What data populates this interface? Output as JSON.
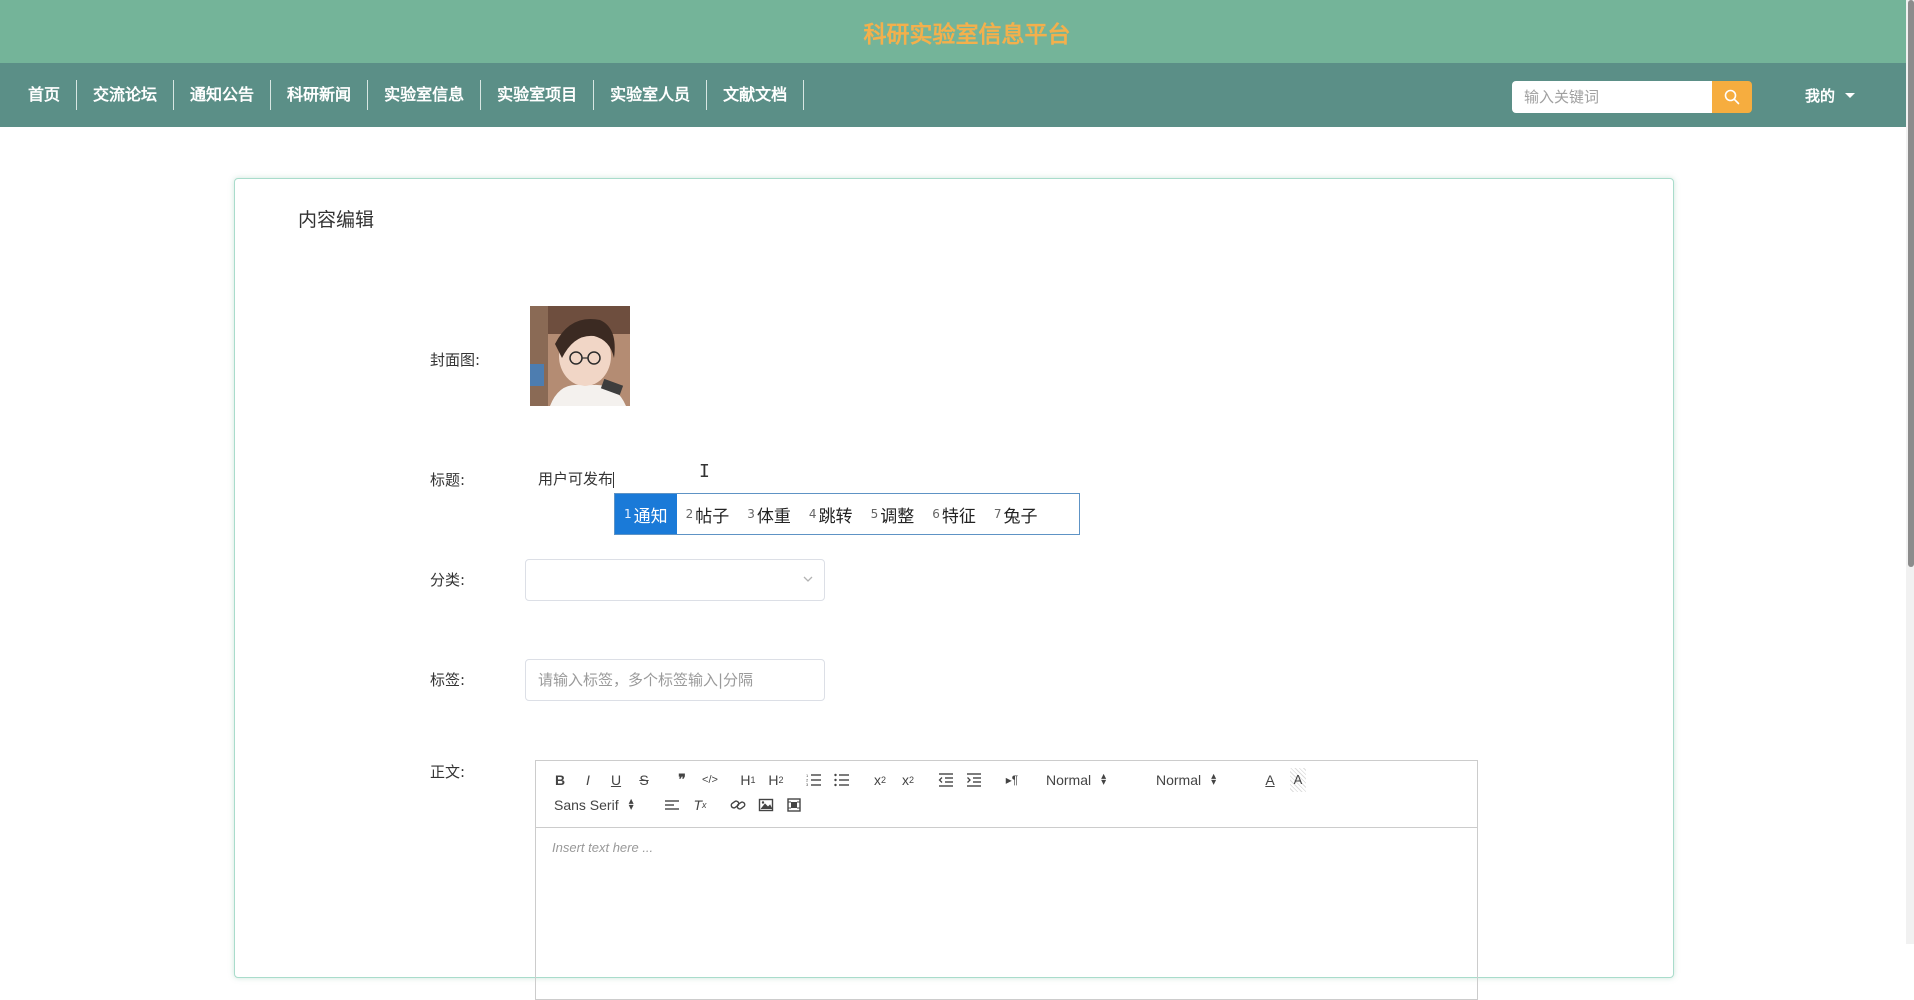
{
  "header": {
    "site_title": "科研实验室信息平台"
  },
  "nav": {
    "items": [
      {
        "label": "首页"
      },
      {
        "label": "交流论坛"
      },
      {
        "label": "通知公告"
      },
      {
        "label": "科研新闻"
      },
      {
        "label": "实验室信息"
      },
      {
        "label": "实验室项目"
      },
      {
        "label": "实验室人员"
      },
      {
        "label": "文献文档"
      }
    ],
    "search_placeholder": "输入关键词",
    "user_menu_label": "我的"
  },
  "form": {
    "card_title": "内容编辑",
    "cover_label": "封面图:",
    "title_label": "标题:",
    "title_value": "用户可发布",
    "category_label": "分类:",
    "category_value": "",
    "tags_label": "标签:",
    "tags_placeholder": "请输入标签，多个标签输入|分隔",
    "body_label": "正文:"
  },
  "ime": {
    "candidates": [
      {
        "num": "1",
        "text": "通知",
        "selected": true
      },
      {
        "num": "2",
        "text": "帖子"
      },
      {
        "num": "3",
        "text": "体重"
      },
      {
        "num": "4",
        "text": "跳转"
      },
      {
        "num": "5",
        "text": "调整"
      },
      {
        "num": "6",
        "text": "特征"
      },
      {
        "num": "7",
        "text": "兔子"
      }
    ]
  },
  "editor": {
    "header_select": "Normal",
    "size_select": "Normal",
    "font_select": "Sans Serif",
    "placeholder": "Insert text here ..."
  },
  "colors": {
    "banner": "#74b499",
    "navbar": "#5b8f87",
    "title": "#f3b04c",
    "search_button": "#f6ad3f",
    "ime_selected": "#1a7ad8"
  }
}
